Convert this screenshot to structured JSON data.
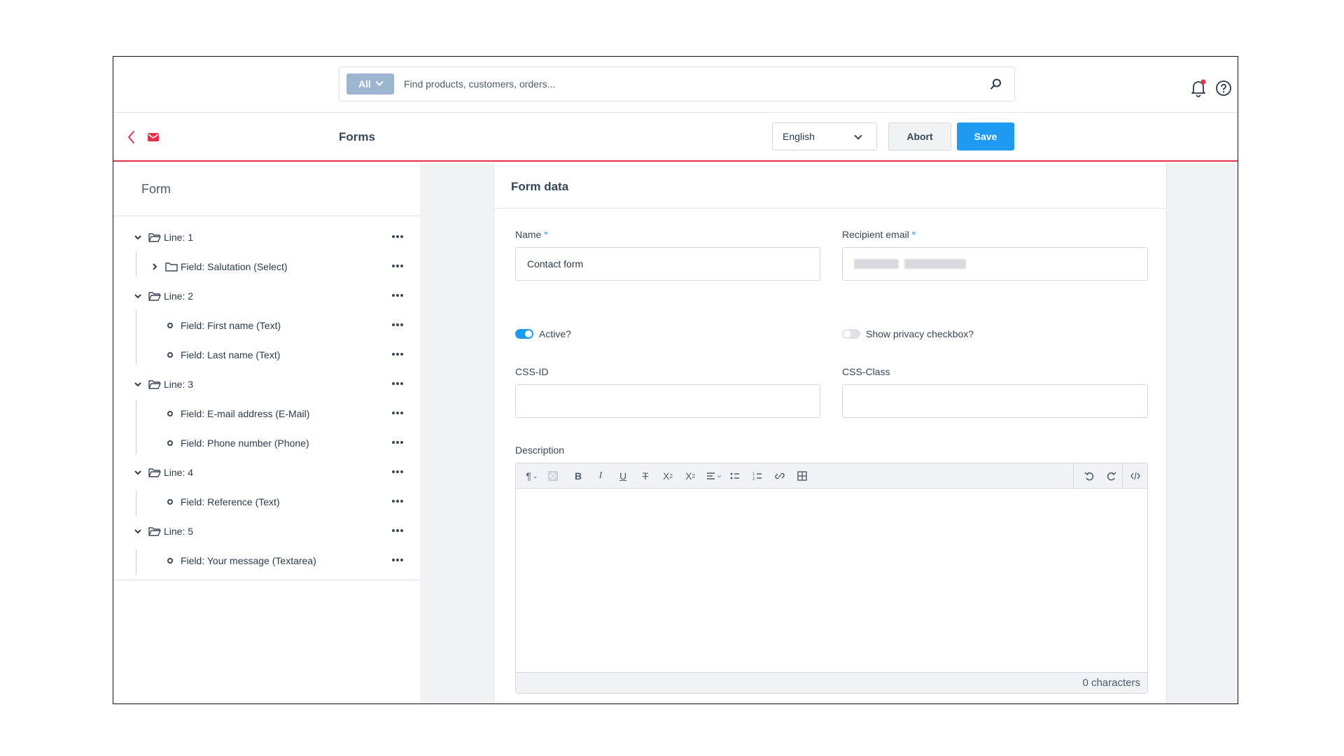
{
  "search": {
    "type_label": "All",
    "placeholder": "Find products, customers, orders..."
  },
  "header": {
    "page_title": "Forms",
    "language": "English",
    "abort_label": "Abort",
    "save_label": "Save"
  },
  "colors": {
    "accent": "#1e9bf0",
    "brand_red": "#e3324a",
    "search_type_bg": "#9db6d0"
  },
  "tree": {
    "title": "Form",
    "items": [
      {
        "label": "Line: 1",
        "kind": "line"
      },
      {
        "label": "Field: Salutation (Select)",
        "kind": "field-folder"
      },
      {
        "label": "Line: 2",
        "kind": "line"
      },
      {
        "label": "Field: First name (Text)",
        "kind": "field"
      },
      {
        "label": "Field: Last name (Text)",
        "kind": "field"
      },
      {
        "label": "Line: 3",
        "kind": "line"
      },
      {
        "label": "Field: E-mail address (E-Mail)",
        "kind": "field"
      },
      {
        "label": "Field: Phone number (Phone)",
        "kind": "field"
      },
      {
        "label": "Line: 4",
        "kind": "line"
      },
      {
        "label": "Field: Reference (Text)",
        "kind": "field"
      },
      {
        "label": "Line: 5",
        "kind": "line"
      },
      {
        "label": "Field: Your message (Textarea)",
        "kind": "field"
      }
    ]
  },
  "form": {
    "title": "Form data",
    "name_label": "Name",
    "name_value": "Contact form",
    "recipient_label": "Recipient email",
    "required_mark": "*",
    "active_label": "Active?",
    "active_on": true,
    "privacy_label": "Show privacy checkbox?",
    "privacy_on": false,
    "css_id_label": "CSS-ID",
    "css_id_value": "",
    "css_class_label": "CSS-Class",
    "css_class_value": "",
    "description_label": "Description",
    "char_count": "0 characters"
  }
}
